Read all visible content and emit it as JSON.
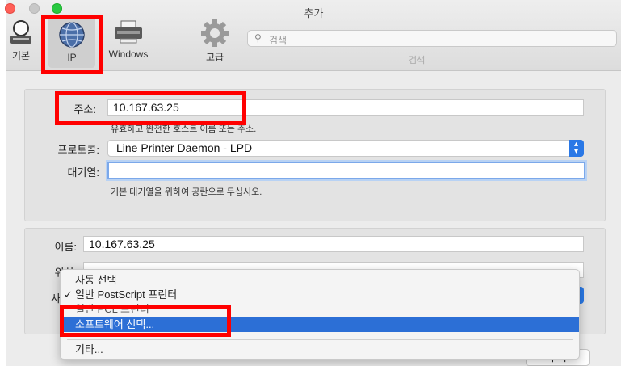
{
  "window": {
    "title": "추가"
  },
  "toolbar": {
    "items": [
      {
        "label": "기본"
      },
      {
        "label": "IP"
      },
      {
        "label": "Windows"
      },
      {
        "label": "고급"
      }
    ],
    "search": {
      "placeholder": "검색",
      "label": "검색"
    }
  },
  "ip_panel": {
    "address_label": "주소:",
    "address_value": "10.167.63.25",
    "address_hint": "유효하고 완전한 호스트 이름 또는 주소.",
    "protocol_label": "프로토콜:",
    "protocol_value": "Line Printer Daemon - LPD",
    "queue_label": "대기열:",
    "queue_value": "",
    "queue_hint": "기본 대기열을 위하여 공란으로 두십시오."
  },
  "info_panel": {
    "name_label": "이름:",
    "name_value": "10.167.63.25",
    "location_label": "위치:",
    "use_label": "사용"
  },
  "driver_menu": {
    "items": [
      {
        "label": "자동 선택",
        "checked": false
      },
      {
        "label": "일반 PostScript 프린터",
        "checked": true
      },
      {
        "label": "일반 PCL 프린터",
        "checked": false
      },
      {
        "label": "소프트웨어 선택...",
        "checked": false,
        "selected": true
      },
      {
        "label": "기타...",
        "checked": false
      }
    ],
    "check_glyph": "✓"
  },
  "footer": {
    "add_label": "추가"
  },
  "colors": {
    "highlight": "#ff0000",
    "menu_selection": "#2c6fd6",
    "focus_ring": "#7ba8ea"
  }
}
